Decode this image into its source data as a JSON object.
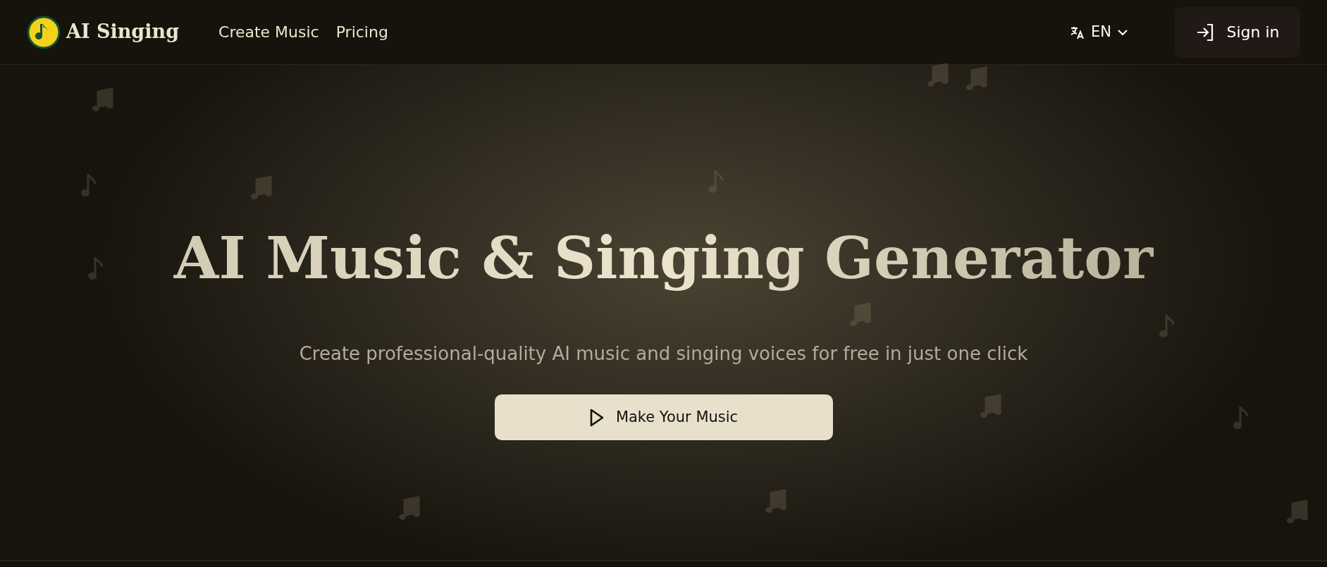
{
  "navbar": {
    "brand": "AI Singing",
    "links": [
      {
        "label": "Create Music"
      },
      {
        "label": "Pricing"
      }
    ],
    "language": "EN",
    "sign_in": "Sign in"
  },
  "hero": {
    "title": "AI Music & Singing Generator",
    "subtitle": "Create professional-quality AI music and singing voices for free in just one click",
    "button": "Make Your Music"
  }
}
